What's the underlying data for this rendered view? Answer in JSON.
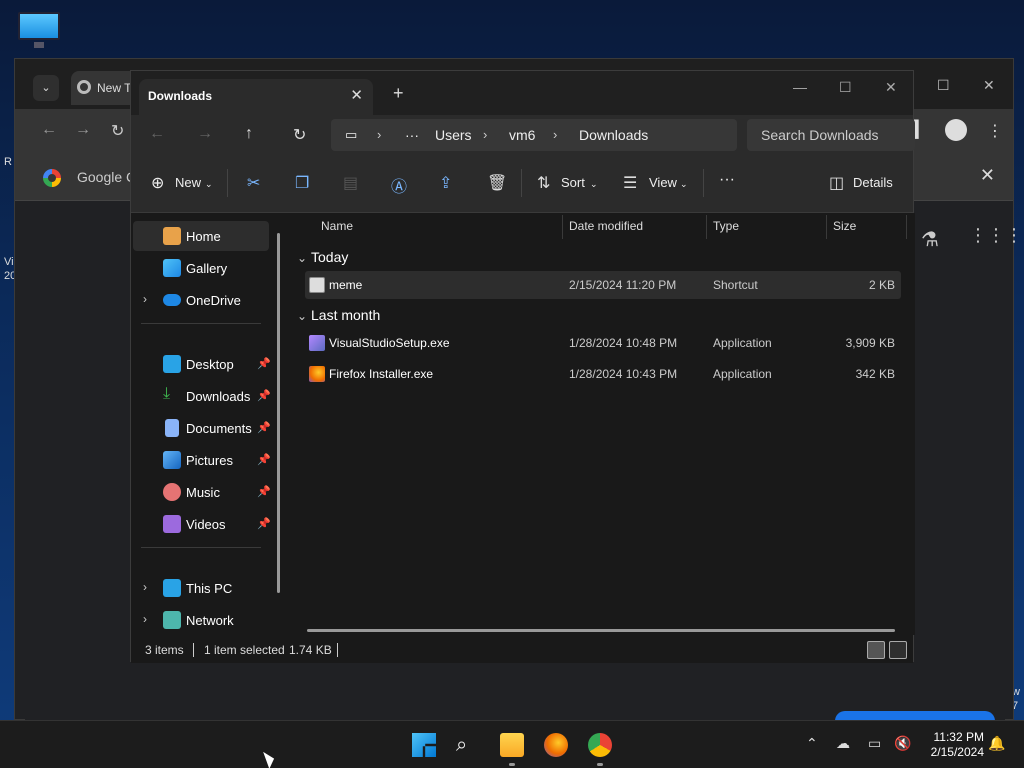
{
  "desktop": {
    "left_fragments": [
      "R",
      "Vi",
      "20"
    ],
    "right_fragments": [
      "w",
      "7"
    ]
  },
  "chrome": {
    "tab_label": "New T",
    "bookmark_text": "Google C"
  },
  "explorer": {
    "tab_title": "Downloads",
    "breadcrumbs": [
      "Users",
      "vm6",
      "Downloads"
    ],
    "search_placeholder": "Search Downloads",
    "commands": {
      "new": "New",
      "sort": "Sort",
      "view": "View",
      "more": "···",
      "details": "Details"
    },
    "sidebar": {
      "items": [
        {
          "label": "Home",
          "icon": "home-icon",
          "selected": true
        },
        {
          "label": "Gallery",
          "icon": "gallery-icon"
        },
        {
          "label": "OneDrive",
          "icon": "cloud-icon",
          "expandable": true
        },
        {
          "label": "Desktop",
          "icon": "desktop-icon",
          "pinned": true
        },
        {
          "label": "Downloads",
          "icon": "download-icon",
          "pinned": true
        },
        {
          "label": "Documents",
          "icon": "document-icon",
          "pinned": true
        },
        {
          "label": "Pictures",
          "icon": "picture-icon",
          "pinned": true
        },
        {
          "label": "Music",
          "icon": "music-icon",
          "pinned": true
        },
        {
          "label": "Videos",
          "icon": "video-icon",
          "pinned": true
        },
        {
          "label": "This PC",
          "icon": "pc-icon",
          "expandable": true
        },
        {
          "label": "Network",
          "icon": "network-icon",
          "expandable": true
        }
      ]
    },
    "columns": {
      "name": "Name",
      "date": "Date modified",
      "type": "Type",
      "size": "Size"
    },
    "groups": [
      {
        "title": "Today",
        "files": [
          {
            "name": "meme",
            "date": "2/15/2024 11:20 PM",
            "type": "Shortcut",
            "size": "2 KB",
            "selected": true
          }
        ]
      },
      {
        "title": "Last month",
        "files": [
          {
            "name": "VisualStudioSetup.exe",
            "date": "1/28/2024 10:48 PM",
            "type": "Application",
            "size": "3,909 KB"
          },
          {
            "name": "Firefox Installer.exe",
            "date": "1/28/2024 10:43 PM",
            "type": "Application",
            "size": "342 KB"
          }
        ]
      }
    ],
    "status": {
      "items": "3 items",
      "selected": "1 item selected",
      "size": "1.74 KB"
    }
  },
  "taskbar": {
    "time": "11:32 PM",
    "date": "2/15/2024"
  }
}
